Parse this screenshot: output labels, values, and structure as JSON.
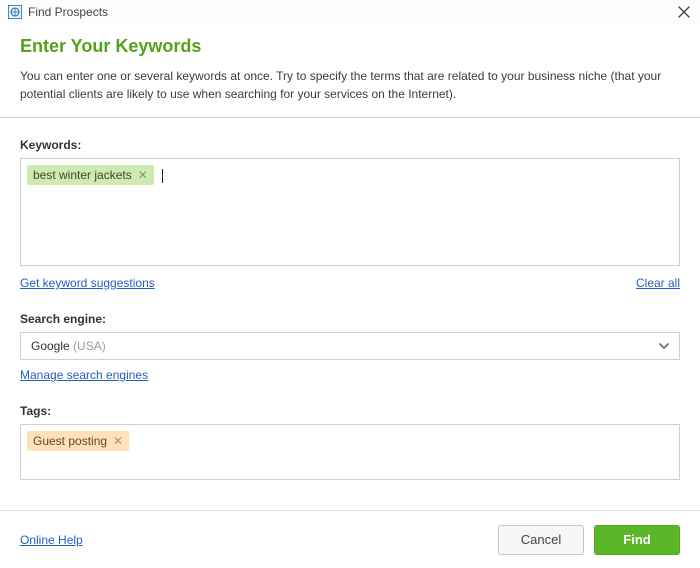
{
  "window": {
    "title": "Find Prospects"
  },
  "header": {
    "title": "Enter Your Keywords",
    "description": "You can enter one or several keywords at once. Try to specify the terms that are related to your business niche (that your potential clients are likely to use when searching for your services on the Internet)."
  },
  "keywords": {
    "label": "Keywords:",
    "items": [
      {
        "text": "best winter jackets"
      }
    ],
    "suggestions_link": "Get keyword suggestions",
    "clear_link": "Clear all"
  },
  "search_engine": {
    "label": "Search engine:",
    "value_main": "Google",
    "value_suffix": " (USA)",
    "manage_link": "Manage search engines"
  },
  "tags": {
    "label": "Tags:",
    "items": [
      {
        "text": "Guest posting"
      }
    ]
  },
  "footer": {
    "help_link": "Online Help",
    "cancel": "Cancel",
    "find": "Find"
  }
}
